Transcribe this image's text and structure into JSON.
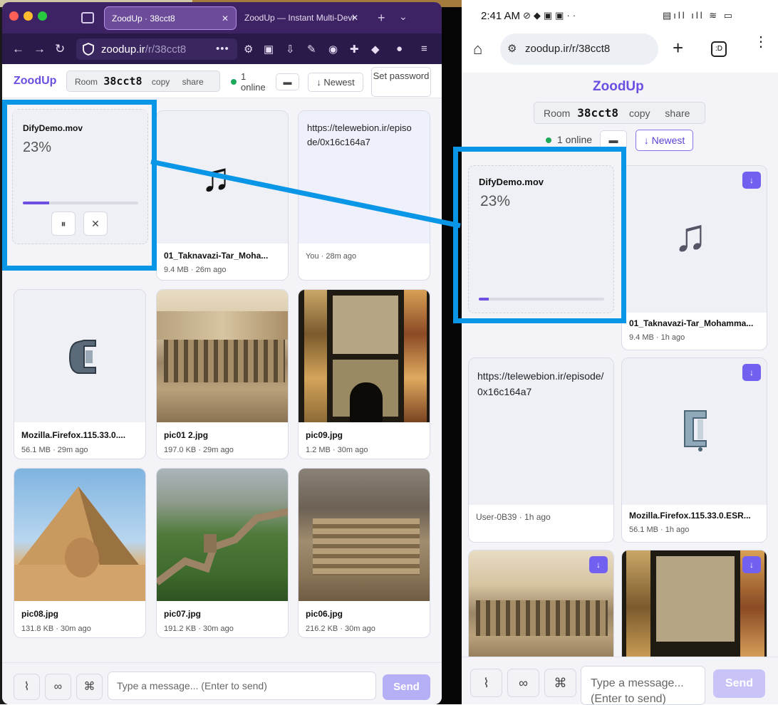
{
  "left": {
    "tabs": [
      {
        "label": "ZoodUp · 38cct8",
        "close": "✕"
      },
      {
        "label": "ZoodUp — Instant Multi-Devi",
        "close": "✕"
      }
    ],
    "url_host": "zoodup.ir",
    "url_path": "/r/38cct8",
    "app": {
      "logo": "ZoodUp",
      "room_label": "Room",
      "room_code": "38cct8",
      "copy": "copy",
      "share": "share",
      "online_count": "1",
      "online_label": "online",
      "newest": "↓ Newest",
      "set_password": "Set password"
    },
    "upload": {
      "name": "DifyDemo.mov",
      "percent": "23%",
      "progress": 0.23
    },
    "cards": [
      {
        "name": "01_Taknavazi-Tar_Moha...",
        "meta": "9.4 MB · 26m ago",
        "icon": "music-note-icon"
      },
      {
        "link": "https://telewebion.ir/episode/0x16c164a7",
        "meta": "You · 28m ago"
      },
      {
        "name": "Mozilla.Firefox.115.33.0....",
        "meta": "56.1 MB · 29m ago",
        "icon": "clamp-icon"
      },
      {
        "name": "pic01 2.jpg",
        "meta": "197.0 KB · 29m ago"
      },
      {
        "name": "pic09.jpg",
        "meta": "1.2 MB · 30m ago"
      },
      {
        "name": "pic08.jpg",
        "meta": "131.8 KB · 30m ago"
      },
      {
        "name": "pic07.jpg",
        "meta": "191.2 KB · 30m ago"
      },
      {
        "name": "pic06.jpg",
        "meta": "216.2 KB · 30m ago"
      }
    ],
    "composer": {
      "placeholder": "Type a message... (Enter to send)",
      "send": "Send"
    }
  },
  "right": {
    "status_time": "2:41 AM",
    "url": "zoodup.ir/r/38cct8",
    "app": {
      "logo": "ZoodUp",
      "room_label": "Room",
      "room_code": "38cct8",
      "copy": "copy",
      "share": "share",
      "online": "1 online",
      "newest": "↓ Newest"
    },
    "upload": {
      "name": "DifyDemo.mov",
      "percent": "23%",
      "progress": 0.08
    },
    "cards": [
      {
        "name": "01_Taknavazi-Tar_Mohamma...",
        "meta": "9.4 MB · 1h ago",
        "icon": "music-note-icon"
      },
      {
        "link": "https://telewebion.ir/episode/0x16c164a7",
        "meta": "User-0B39 · 1h ago"
      },
      {
        "name": "Mozilla.Firefox.115.33.0.ESR...",
        "meta": "56.1 MB · 1h ago",
        "icon": "clamp-icon"
      }
    ],
    "download_glyph": "↓",
    "composer": {
      "placeholder": "Type a message... (Enter to send)",
      "send": "Send"
    }
  }
}
